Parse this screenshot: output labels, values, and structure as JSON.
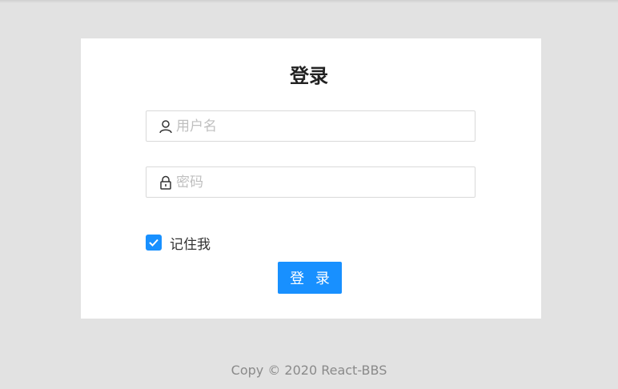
{
  "login_form": {
    "title": "登录",
    "username": {
      "placeholder": "用户名",
      "value": "",
      "icon": "user-icon"
    },
    "password": {
      "placeholder": "密码",
      "value": "",
      "icon": "lock-icon"
    },
    "remember": {
      "label": "记住我",
      "checked": true
    },
    "submit_label": "登 录",
    "accent_color": "#1890ff"
  },
  "footer": {
    "text": "Copy © 2020 React-BBS"
  }
}
